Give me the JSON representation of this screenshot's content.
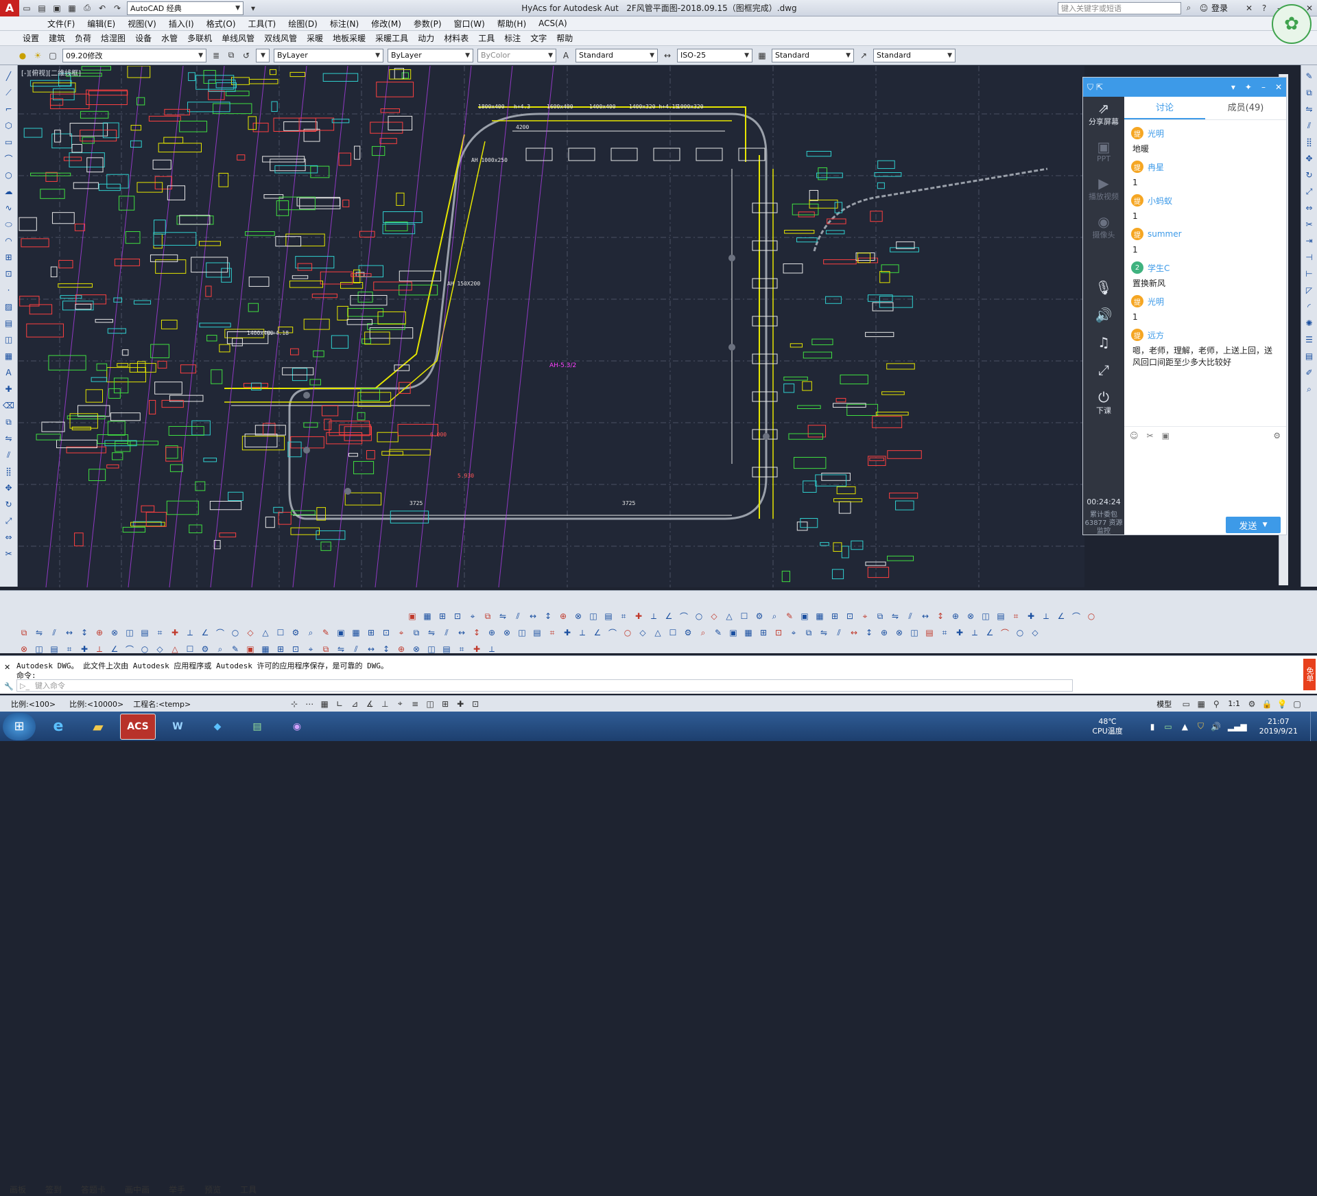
{
  "titlebar": {
    "workspace": "AutoCAD 经典",
    "title": "HyAcs for Autodesk Aut",
    "document": "2F风管平面图-2018.09.15（图框完成）.dwg",
    "search_placeholder": "键入关键字或短语",
    "login": "登录"
  },
  "menu": [
    "文件(F)",
    "编辑(E)",
    "视图(V)",
    "插入(I)",
    "格式(O)",
    "工具(T)",
    "绘图(D)",
    "标注(N)",
    "修改(M)",
    "参数(P)",
    "窗口(W)",
    "帮助(H)",
    "ACS(A)"
  ],
  "ribbon": [
    "设置",
    "建筑",
    "负荷",
    "焓湿图",
    "设备",
    "水管",
    "多联机",
    "单线风管",
    "双线风管",
    "采暖",
    "地板采暖",
    "采暖工具",
    "动力",
    "材料表",
    "工具",
    "标注",
    "文字",
    "帮助"
  ],
  "props": {
    "layer": "09.20修改",
    "linetype1": "ByLayer",
    "linetype2": "ByLayer",
    "color": "ByColor",
    "textstyle": "Standard",
    "dimstyle": "ISO-25",
    "tablestyle": "Standard",
    "mleaderstyle": "Standard"
  },
  "canvas": {
    "viewport_label": "[-][俯视][二维线框]",
    "center_tag": "AH-5.3/2"
  },
  "drawing_labels": [
    {
      "text": "1800x400",
      "color": "#e8e8e8"
    },
    {
      "text": "h+4.3",
      "color": "#e8e8e8"
    },
    {
      "text": "1600x400",
      "color": "#e8e8e8"
    },
    {
      "text": "1400x400",
      "color": "#e8e8e8"
    },
    {
      "text": "1400x320 h+4.15",
      "color": "#e8e8e8"
    },
    {
      "text": "1000x320",
      "color": "#e8e8e8"
    },
    {
      "text": "4200",
      "color": "#e8e8e8"
    },
    {
      "text": "AH 1000x250",
      "color": "#e8e8e8"
    },
    {
      "text": "AH 150X200",
      "color": "#e8e8e8"
    },
    {
      "text": "1400x400",
      "color": "#e8e8e8"
    },
    {
      "text": "h+4.18",
      "color": "#e8e8e8"
    },
    {
      "text": "6.000",
      "color": "#ff5555"
    },
    {
      "text": "5.930",
      "color": "#ff5555"
    },
    {
      "text": "3725",
      "color": "#e8e8e8"
    },
    {
      "text": "3725",
      "color": "#e8e8e8"
    }
  ],
  "palette_tabs": [
    "画板",
    "签到",
    "答题卡",
    "画中画",
    "举手",
    "预览",
    "工具"
  ],
  "command": {
    "line1": "Autodesk DWG。  此文件上次由 Autodesk 应用程序或 Autodesk 许可的应用程序保存，是可靠的 DWG。",
    "line2": "命令:",
    "placeholder": "键入命令"
  },
  "status": {
    "scale": "比例:<100>",
    "ratio": "比例:<10000>",
    "project": "工程名:<temp>",
    "model": "模型",
    "annot_scale": "1:1"
  },
  "chat": {
    "tabs": [
      "讨论",
      "成员(49)"
    ],
    "active_tab": 0,
    "share_label": "分享屏幕",
    "side_items": [
      "PPT",
      "播放视频",
      "摄像头"
    ],
    "end_label": "下课",
    "timer": "00:24:24",
    "stats": "累计委包 63877 资源监控",
    "send_label": "发送",
    "messages": [
      {
        "user": "光明",
        "badge": "提",
        "text": "地暖"
      },
      {
        "user": "冉星",
        "badge": "提",
        "text": "1"
      },
      {
        "user": "小蚂蚁",
        "badge": "提",
        "text": "1"
      },
      {
        "user": "summer",
        "badge": "提",
        "text": "1"
      },
      {
        "user": "学生C",
        "badge": "2",
        "text": "置换新风"
      },
      {
        "user": "光明",
        "badge": "提",
        "text": "1"
      },
      {
        "user": "远方",
        "badge": "提",
        "text": "嗯，老师，理解，老师，上送上回，送风回口间距至少多大比较好"
      }
    ]
  },
  "tray": {
    "temp": "48℃",
    "temp_label": "CPU温度",
    "time": "21:07",
    "date": "2019/9/21"
  },
  "taskbar_apps": [
    "ACS"
  ],
  "colors": {
    "accent": "#3d9ae8",
    "canvas": "#212736",
    "cad_yellow": "#e6e600",
    "cad_magenta": "#c040ff",
    "cad_red": "#ff4040",
    "cad_green": "#40e040",
    "cad_cyan": "#30d0d0"
  }
}
